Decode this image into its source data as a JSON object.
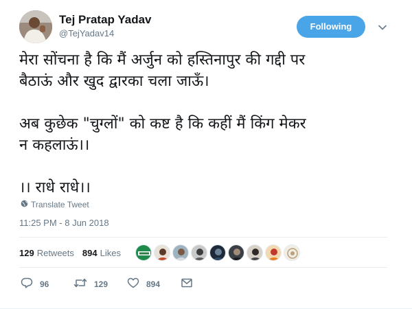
{
  "author": {
    "name": "Tej Pratap Yadav",
    "handle": "@TejYadav14"
  },
  "header": {
    "follow_label": "Following"
  },
  "tweet": {
    "lines": [
      "मेरा सोंचना है कि मैं अर्जुन को हस्तिनापुर की गद्दी पर",
      "बैठाऊं और खुद द्वारका चला जाऊँ।",
      "अब कुछेक \"चुग्लों\" को कष्ट है कि कहीं मैं किंग मेकर",
      "न कहलाऊं।।",
      "।। राधे राधे।।"
    ],
    "translate_label": "Translate Tweet",
    "timestamp": "11:25 PM - 8 Jun 2018"
  },
  "stats": {
    "retweets_count": "129",
    "retweets_label": "Retweets",
    "likes_count": "894",
    "likes_label": "Likes"
  },
  "actions": {
    "reply_count": "96",
    "retweet_count": "129",
    "like_count": "894"
  },
  "colors": {
    "follow_button": "#4aa4e8",
    "text_primary": "#14171a",
    "text_secondary": "#657786",
    "divider": "#e6ecf0"
  },
  "icons": [
    "globe-icon",
    "chevron-down-icon",
    "reply-icon",
    "retweet-icon",
    "like-icon",
    "message-icon"
  ]
}
